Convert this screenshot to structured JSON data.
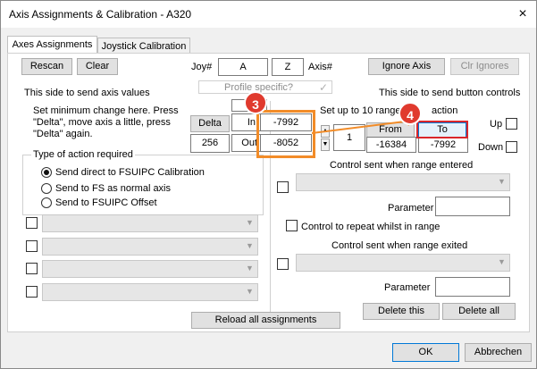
{
  "window": {
    "title": "Axis Assignments & Calibration - A320",
    "close_icon": "×"
  },
  "tabs": [
    {
      "label": "Axes Assignments",
      "active": true
    },
    {
      "label": "Joystick Calibration",
      "active": false
    }
  ],
  "toolbar": {
    "rescan_label": "Rescan",
    "clear_label": "Clear",
    "joy_label": "Joy#",
    "joy_value": "A",
    "axis_value": "Z",
    "axis_label": "Axis#",
    "ignore_axis_label": "Ignore Axis",
    "clr_ignores_label": "Clr Ignores",
    "profile_specific_label": "Profile specific?"
  },
  "left": {
    "heading": "This side to send axis values",
    "instructions_line1": "Set minimum change  here.  Press",
    "instructions_line2": "\"Delta\", move axis a little,  press",
    "instructions_line3": "\"Delta\" again.",
    "delta_label": "Delta",
    "delta_value": "256",
    "in_label": "In",
    "in_value": "-7992",
    "out_label": "Out",
    "out_value": "-8052",
    "action_group_title": "Type of action required",
    "radio_fsuipc_cal": "Send direct to FSUIPC Calibration",
    "radio_fs_normal": "Send to FS as normal axis",
    "radio_fsuipc_offset": "Send to FSUIPC Offset",
    "reload_label": "Reload all assignments"
  },
  "right": {
    "heading": "This side to send button controls",
    "ranges_label_a": "Set up to 10 range",
    "ranges_label_b": "action",
    "range_index": "1",
    "from_label": "From",
    "to_label": "To",
    "from_value": "-16384",
    "to_value": "-7992",
    "up_label": "Up",
    "down_label": "Down",
    "entered_label": "Control sent when range entered",
    "parameter_label": "Parameter",
    "repeat_label": "Control to repeat whilst in range",
    "exited_label": "Control sent when range exited",
    "parameter2_label": "Parameter",
    "delete_this_label": "Delete this",
    "delete_all_label": "Delete all"
  },
  "footer": {
    "ok_label": "OK",
    "cancel_label": "Abbrechen"
  },
  "annotations": {
    "badge3": "3",
    "badge4": "4"
  },
  "colors": {
    "highlight_orange": "#f28c28",
    "highlight_red": "#d9262b",
    "badge": "#e03a2e"
  }
}
